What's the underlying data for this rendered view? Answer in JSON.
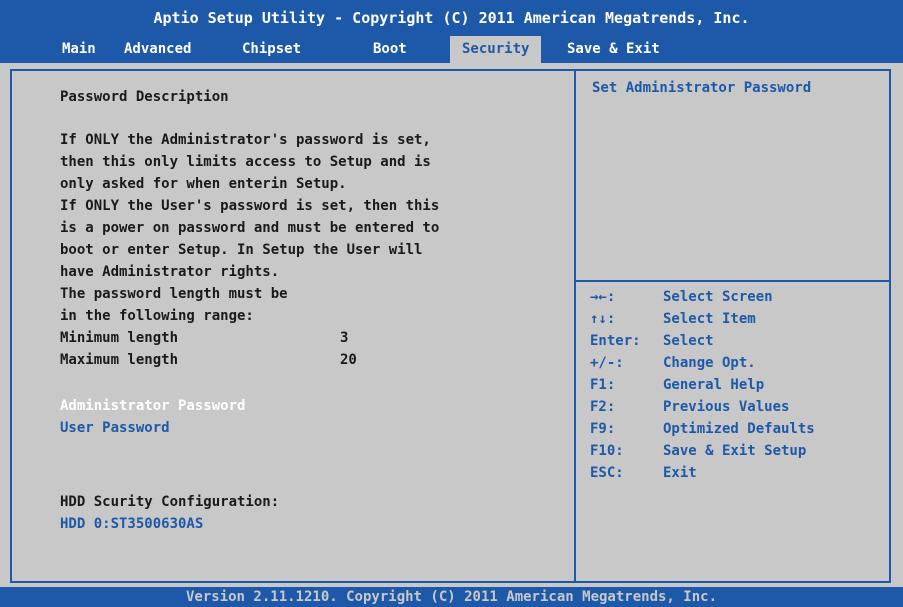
{
  "title": "Aptio Setup Utility - Copyright (C) 2011 American Megatrends, Inc.",
  "tabs": [
    {
      "label": "Main"
    },
    {
      "label": "Advanced"
    },
    {
      "label": "Chipset"
    },
    {
      "label": "Boot"
    },
    {
      "label": "Security",
      "active": true
    },
    {
      "label": "Save & Exit"
    }
  ],
  "left": {
    "heading": "Password Description",
    "description": [
      "If ONLY the Administrator's password is set,",
      "then this only limits access to Setup and is",
      "only asked for when enterin Setup.",
      "If ONLY the User's password is set, then this",
      "is a power on password and must be entered to",
      "boot or enter Setup. In Setup the User will",
      "have Administrator rights.",
      "The password length must be",
      "in the following range:"
    ],
    "min_label": "Minimum length",
    "min_value": "3",
    "max_label": "Maximum length",
    "max_value": "20",
    "admin_password": "Administrator Password",
    "user_password": "User Password",
    "hdd_heading": "HDD Scurity Configuration:",
    "hdd_item": "HDD 0:ST3500630AS"
  },
  "help_text": "Set Administrator Password",
  "key_help": [
    {
      "key": "→←:",
      "action": "Select Screen"
    },
    {
      "key": "↑↓:",
      "action": "Select Item"
    },
    {
      "key": "Enter:",
      "action": "Select"
    },
    {
      "key": "+/-:",
      "action": "Change Opt."
    },
    {
      "key": "F1:",
      "action": "General Help"
    },
    {
      "key": "F2:",
      "action": "Previous Values"
    },
    {
      "key": "F9:",
      "action": "Optimized Defaults"
    },
    {
      "key": "F10:",
      "action": "Save & Exit Setup"
    },
    {
      "key": "ESC:",
      "action": "Exit"
    }
  ],
  "footer": "Version 2.11.1210. Copyright (C) 2011 American Megatrends, Inc.",
  "colors": {
    "accent": "#1d59a8",
    "background": "#c8c8c8",
    "text": "#1a1a1a",
    "highlight": "#ffffff"
  }
}
